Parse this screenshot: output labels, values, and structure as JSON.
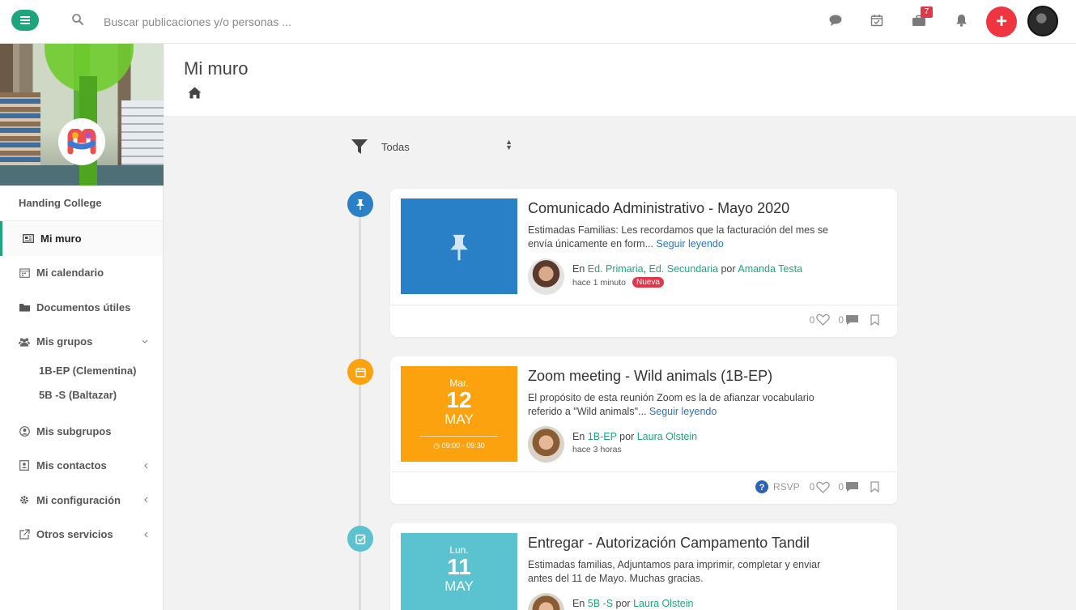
{
  "topbar": {
    "search_placeholder": "Buscar publicaciones y/o personas ...",
    "icons": [
      "menu-icon",
      "search-icon",
      "chat-icon",
      "calendar-check-icon",
      "briefcase-icon",
      "bell-icon",
      "plus-icon"
    ],
    "notifications_badge": "7",
    "add_label": "+"
  },
  "sidebar": {
    "org_name": "Handing College",
    "items": [
      {
        "label": "Mi muro",
        "icon": "newspaper-icon",
        "active": true
      },
      {
        "label": "Mi calendario",
        "icon": "calendar-icon"
      },
      {
        "label": "Documentos útiles",
        "icon": "folder-icon"
      },
      {
        "label": "Mis grupos",
        "icon": "users-icon",
        "chevron": "down"
      },
      {
        "label": "Mis subgrupos",
        "icon": "user-circle-icon"
      },
      {
        "label": "Mis contactos",
        "icon": "address-book-icon",
        "chevron": "left"
      },
      {
        "label": "Mi configuración",
        "icon": "gear-icon",
        "chevron": "left"
      },
      {
        "label": "Otros servicios",
        "icon": "external-link-icon",
        "chevron": "left"
      }
    ],
    "groups": [
      "1B-EP (Clementina)",
      "5B -S (Baltazar)"
    ]
  },
  "page": {
    "title": "Mi muro"
  },
  "filter": {
    "selected": "Todas"
  },
  "posts": [
    {
      "type": "pin",
      "color": "#2a80c6",
      "dot_color": "#2a80c6",
      "title": "Comunicado Administrativo - Mayo 2020",
      "excerpt": "Estimadas Familias: Les recordamos que la facturación del mes se envía únicamente en form... ",
      "read_more": "Seguir leyendo",
      "in_label": "En",
      "groups": [
        "Ed. Primaria",
        "Ed. Secundaria"
      ],
      "by_label": "por",
      "author": "Amanda Testa",
      "time_ago": "hace 1 minuto",
      "badge": "Nueva",
      "likes": "0",
      "comments": "0"
    },
    {
      "type": "event",
      "color": "#fba20e",
      "dot_color": "#fba20e",
      "dow": "Mar.",
      "day": "12",
      "month": "MAY",
      "time": "09:00 - 09:30",
      "title": "Zoom meeting - Wild animals (1B-EP)",
      "excerpt": "El propósito de esta reunión Zoom es la de afianzar vocabulario referido a \"Wild animals\"... ",
      "read_more": "Seguir leyendo",
      "in_label": "En",
      "groups": [
        "1B-EP"
      ],
      "by_label": "por",
      "author": "Laura Olstein",
      "time_ago": "hace 3 horas",
      "rsvp": "RSVP",
      "likes": "0",
      "comments": "0"
    },
    {
      "type": "task",
      "color": "#5bc2cf",
      "dot_color": "#5bc2cf",
      "dow": "Lun.",
      "day": "11",
      "month": "MAY",
      "title": "Entregar - Autorización Campamento Tandil",
      "excerpt": "Estimadas familias, Adjuntamos para imprimir, completar y enviar antes del 11 de Mayo. Muchas gracias.",
      "in_label": "En",
      "groups": [
        "5B -S"
      ],
      "by_label": "por",
      "author": "Laura Olstein"
    }
  ]
}
